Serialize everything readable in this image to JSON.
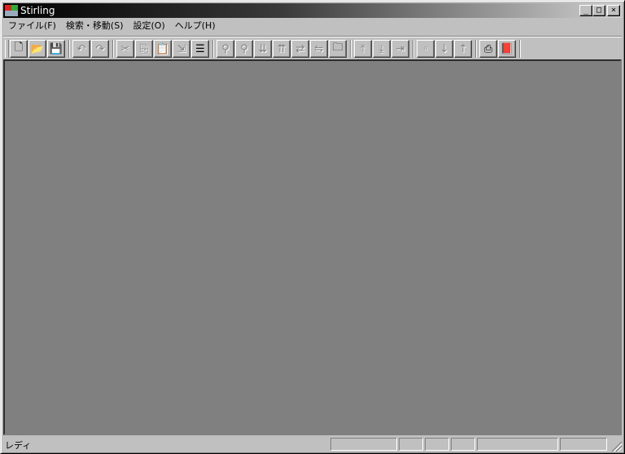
{
  "window": {
    "title": "Stirling",
    "minimize_glyph": "_",
    "maximize_glyph": "□",
    "close_glyph": "×"
  },
  "menu": [
    {
      "label": "ファイル(F)"
    },
    {
      "label": "検索・移動(S)"
    },
    {
      "label": "設定(O)"
    },
    {
      "label": "ヘルプ(H)"
    }
  ],
  "toolbar": {
    "buttons": [
      {
        "name": "new-file",
        "icon": "new-doc-icon",
        "glyph": "🗋",
        "enabled": true
      },
      {
        "name": "open-file",
        "icon": "open-folder-icon",
        "glyph": "📂",
        "enabled": true
      },
      {
        "name": "save-file",
        "icon": "floppy-disk-icon",
        "glyph": "💾",
        "enabled": true
      },
      {
        "name": "undo",
        "icon": "undo-icon",
        "glyph": "↶",
        "enabled": false
      },
      {
        "name": "redo",
        "icon": "redo-icon",
        "glyph": "↷",
        "enabled": false
      },
      {
        "name": "cut",
        "icon": "scissors-icon",
        "glyph": "✂",
        "enabled": false
      },
      {
        "name": "copy",
        "icon": "copy-icon",
        "glyph": "⎘",
        "enabled": false
      },
      {
        "name": "paste",
        "icon": "paste-icon",
        "glyph": "📋",
        "enabled": false
      },
      {
        "name": "paste-special",
        "icon": "paste-special-icon",
        "glyph": "⇲",
        "enabled": false
      },
      {
        "name": "list",
        "icon": "list-icon",
        "glyph": "☰",
        "enabled": true
      },
      {
        "name": "find",
        "icon": "binoculars-icon",
        "glyph": "⚲",
        "enabled": false
      },
      {
        "name": "find-hex",
        "icon": "find-hex-icon",
        "glyph": "⚲",
        "enabled": false
      },
      {
        "name": "find-next",
        "icon": "find-next-icon",
        "glyph": "⇊",
        "enabled": false
      },
      {
        "name": "find-prev",
        "icon": "find-prev-icon",
        "glyph": "⇈",
        "enabled": false
      },
      {
        "name": "replace",
        "icon": "replace-icon",
        "glyph": "⇄",
        "enabled": false
      },
      {
        "name": "compare",
        "icon": "compare-icon",
        "glyph": "⇋",
        "enabled": false
      },
      {
        "name": "jump",
        "icon": "jump-folder-icon",
        "glyph": "🗀",
        "enabled": true
      },
      {
        "name": "move-top",
        "icon": "move-top-icon",
        "glyph": "⤒",
        "enabled": false
      },
      {
        "name": "move-bottom",
        "icon": "move-bottom-icon",
        "glyph": "⤓",
        "enabled": false
      },
      {
        "name": "move-address",
        "icon": "move-address-icon",
        "glyph": "⇥",
        "enabled": false
      },
      {
        "name": "marker",
        "icon": "marker-icon",
        "glyph": "◦",
        "enabled": false
      },
      {
        "name": "marker-down",
        "icon": "marker-down-icon",
        "glyph": "↓",
        "enabled": false
      },
      {
        "name": "marker-up",
        "icon": "marker-up-icon",
        "glyph": "↑",
        "enabled": false
      },
      {
        "name": "print",
        "icon": "printer-icon",
        "glyph": "⎙",
        "enabled": true
      },
      {
        "name": "help",
        "icon": "help-book-icon",
        "glyph": "📕",
        "enabled": true
      }
    ]
  },
  "status": {
    "text": "レディ"
  }
}
